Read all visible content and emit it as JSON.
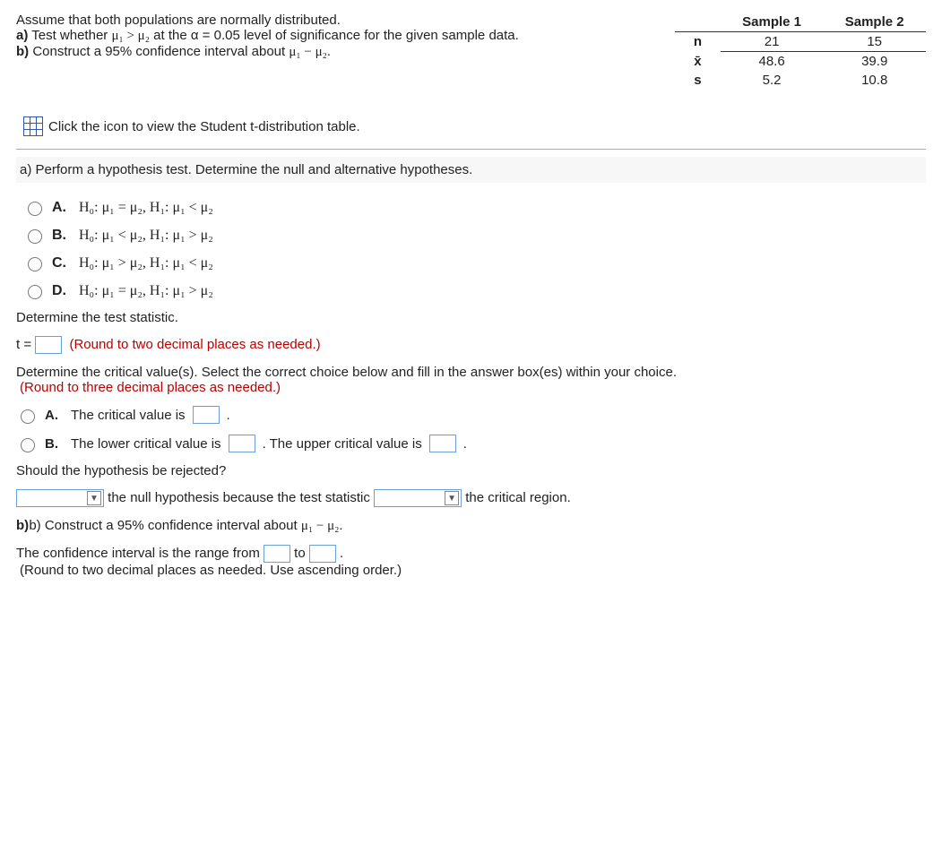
{
  "problem": {
    "line1": "Assume that both populations are normally distributed.",
    "line2a": "a)",
    "line2b": " Test whether ",
    "mu1gtmu2": "μ₁ > μ₂",
    "line2c": " at the α = 0.05 level of significance for the given sample data.",
    "line3a": "b)",
    "line3b": " Construct a 95% confidence interval about ",
    "mudiff": "μ₁ − μ₂",
    "line3c": "."
  },
  "table": {
    "h1": "Sample 1",
    "h2": "Sample 2",
    "rows": [
      {
        "label": "n",
        "s1": "21",
        "s2": "15"
      },
      {
        "label": "x̄",
        "s1": "48.6",
        "s2": "39.9"
      },
      {
        "label": "s",
        "s1": "5.2",
        "s2": "10.8"
      }
    ]
  },
  "link_tdist": "Click the icon to view the Student t-distribution table.",
  "part_a_prompt": "a) Perform a hypothesis test. Determine the null and alternative hypotheses.",
  "options": {
    "A": "H₀: μ₁ = μ₂, H₁: μ₁ < μ₂",
    "B": "H₀: μ₁ < μ₂, H₁: μ₁ > μ₂",
    "C": "H₀: μ₁ > μ₂, H₁: μ₁ < μ₂",
    "D": "H₀: μ₁ = μ₂, H₁: μ₁ > μ₂"
  },
  "det_test_stat": "Determine the test statistic.",
  "t_equals": "t =",
  "round2": "(Round to two decimal places as needed.)",
  "det_crit": "Determine the critical value(s). Select the correct choice below and fill in the answer box(es) within your choice.",
  "round3": "(Round to three decimal places as needed.)",
  "critA_pre": "The critical value is ",
  "critB_pre": "The lower critical value is ",
  "critB_mid": ". The upper critical value is ",
  "should_reject": "Should the hypothesis be rejected?",
  "reject_mid": " the null hypothesis because the test statistic ",
  "reject_end": " the critical region.",
  "part_b_prompt_pre": "b) Construct a 95% confidence interval about ",
  "ci_line_pre": "The confidence interval is the range from ",
  "ci_line_mid": " to ",
  "ci_hint": "(Round to two decimal places as needed. Use ascending order.)",
  "letters": {
    "A": "A.",
    "B": "B.",
    "C": "C.",
    "D": "D."
  },
  "period": "."
}
